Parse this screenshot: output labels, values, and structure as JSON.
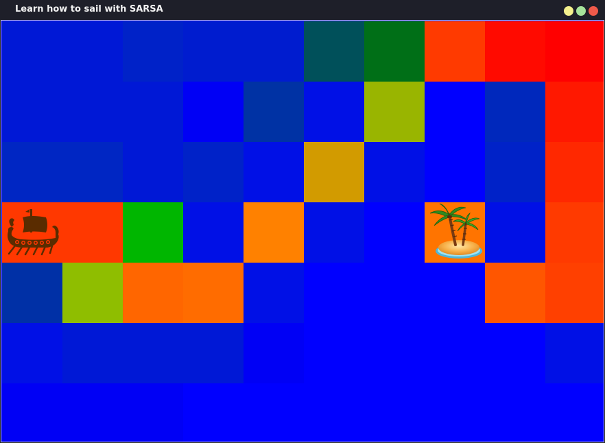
{
  "window": {
    "title": "Learn how to sail with SARSA",
    "controls": [
      {
        "name": "minimize-button",
        "color": "#f4f08d"
      },
      {
        "name": "maximize-button",
        "color": "#a6e39b"
      },
      {
        "name": "close-button",
        "color": "#f05a4a"
      }
    ]
  },
  "grid": {
    "rows": 7,
    "cols": 10,
    "cells": [
      [
        "#0018d6",
        "#0018d6",
        "#0022c8",
        "#001ccf",
        "#001ccf",
        "#00505a",
        "#006f17",
        "#ff3a00",
        "#ff0a00",
        "#ff0000"
      ],
      [
        "#0018d6",
        "#0018d6",
        "#0018d6",
        "#0000f5",
        "#0032a4",
        "#0010e6",
        "#99b500",
        "#0000ff",
        "#0028bc",
        "#ff1800"
      ],
      [
        "#0026c3",
        "#0026c3",
        "#0018d6",
        "#0022c8",
        "#0010e6",
        "#d29b00",
        "#0010e6",
        "#0000ff",
        "#0022c8",
        "#ff2800"
      ],
      [
        "#ff3800",
        "#ff3800",
        "#00b600",
        "#0010e6",
        "#ff8100",
        "#0010e6",
        "#0000ff",
        "#ff7400",
        "#0010e6",
        "#ff3a00"
      ],
      [
        "#0030a6",
        "#8fbe00",
        "#ff6600",
        "#ff6c00",
        "#0010e6",
        "#0000ff",
        "#0000ff",
        "#0000ff",
        "#ff5600",
        "#ff4000"
      ],
      [
        "#0010e6",
        "#0018d6",
        "#0018d6",
        "#0018d6",
        "#0000f5",
        "#0000ff",
        "#0000ff",
        "#0000ff",
        "#0000ff",
        "#0010e6"
      ],
      [
        "#0000f5",
        "#0000f5",
        "#0000f5",
        "#0000ff",
        "#0000ff",
        "#0000ff",
        "#0000ff",
        "#0000ff",
        "#0000ff",
        "#0000ff"
      ]
    ],
    "ship": {
      "row": 3,
      "col": 0,
      "icon": "viking-ship-icon",
      "color": "#5a2c00"
    },
    "goal": {
      "row": 3,
      "col": 7,
      "icon": "palm-island-icon"
    }
  }
}
